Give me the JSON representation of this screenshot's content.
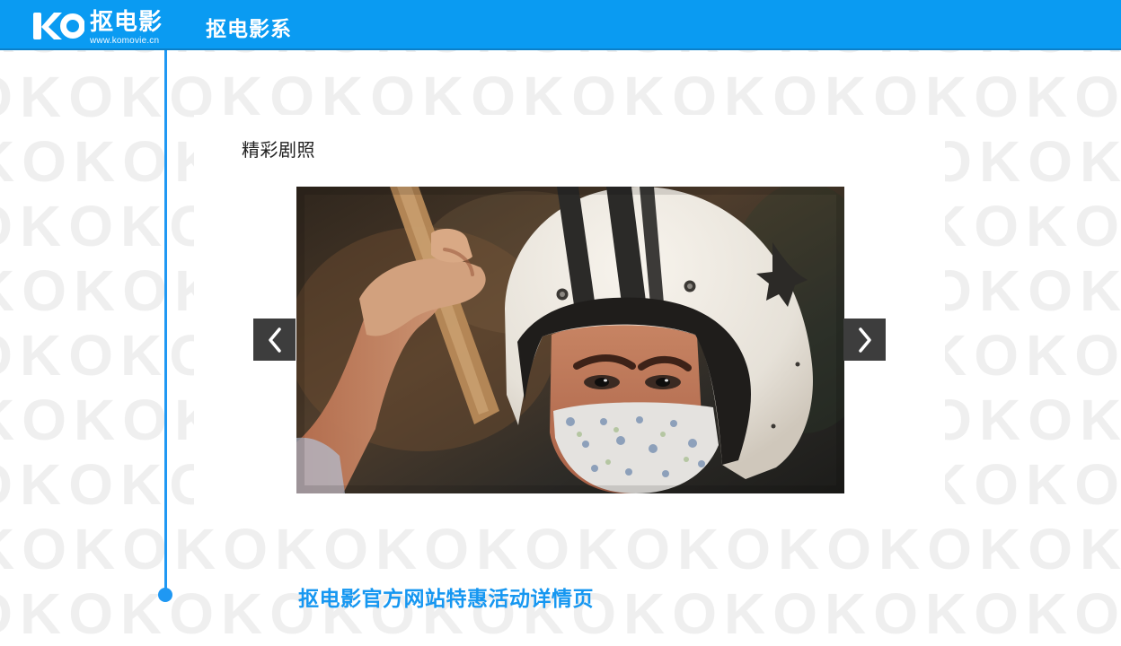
{
  "brand": {
    "logo_mark": "KO",
    "name": "抠电影",
    "url": "www.komovie.cn"
  },
  "header": {
    "title": "抠电影系"
  },
  "section": {
    "title": "精彩剧照"
  },
  "gallery": {
    "prev_icon": "chevron-left-icon",
    "next_icon": "chevron-right-icon"
  },
  "footer": {
    "link": "抠电影官方网站特惠活动详情页"
  },
  "colors": {
    "header_blue": "#0a9bf2",
    "accent_blue": "#1f98f3",
    "nav_button_bg": "#3d3d3d",
    "text_dark": "#222222"
  }
}
